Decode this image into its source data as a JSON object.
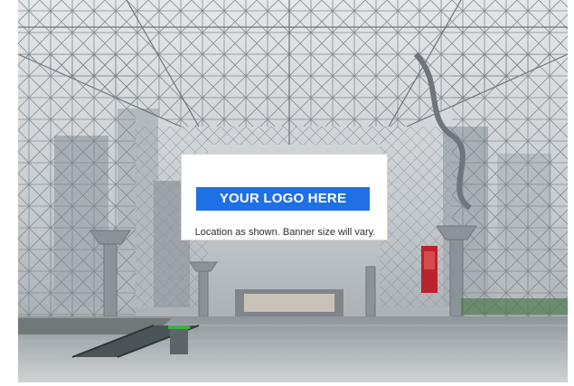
{
  "background": {
    "icon": "convention-center-atrium-photo"
  },
  "banner": {
    "logo_text": "YOUR LOGO HERE",
    "caption": "Location as shown. Banner size will vary.",
    "logo_color": "#1f6fe5",
    "background_color": "#ffffff"
  }
}
